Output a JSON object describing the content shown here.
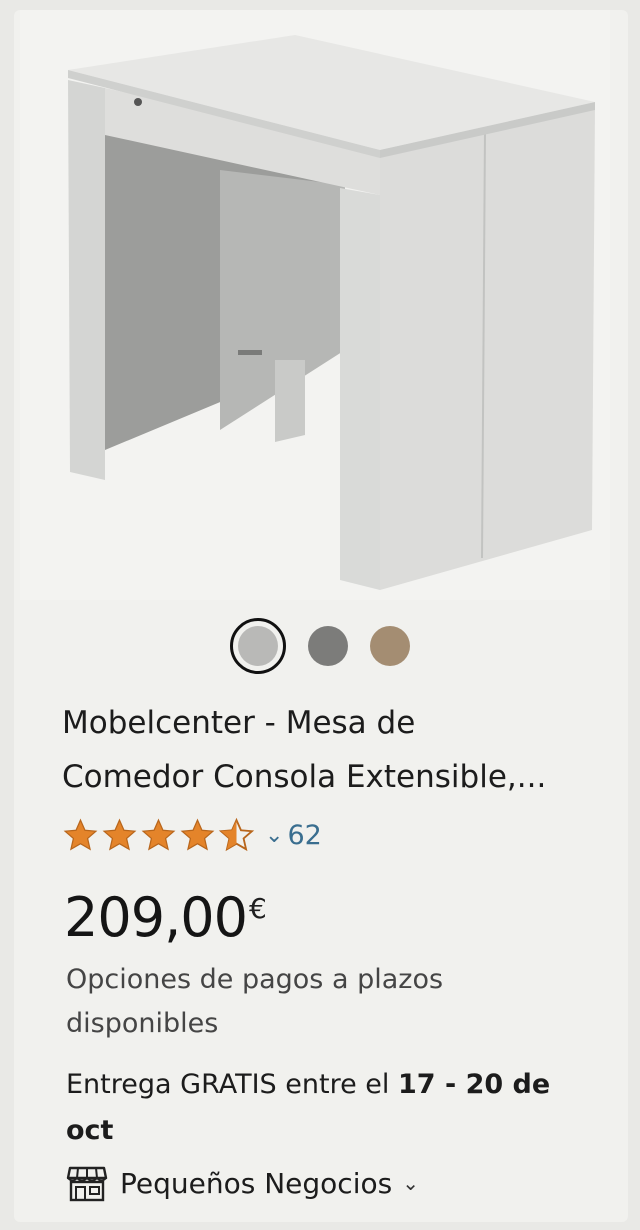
{
  "colors": {
    "star": "#e4842a",
    "link": "#3a6e8f",
    "swatch_white": "#b9b9b7",
    "swatch_grey": "#7c7c7a",
    "swatch_oak": "#a48d72"
  },
  "swatches": [
    {
      "name": "white",
      "color": "#b9b9b7",
      "selected": true
    },
    {
      "name": "grey",
      "color": "#7c7c7a",
      "selected": false
    },
    {
      "name": "oak",
      "color": "#a48d72",
      "selected": false
    }
  ],
  "product": {
    "title_line1": "Mobelcenter - Mesa de",
    "title_line2": "Comedor Consola Extensible,...",
    "rating": 4.5,
    "rating_count": "62",
    "price_amount": "209,00",
    "price_currency": "€",
    "installments_line1": "Opciones de pagos a plazos",
    "installments_line2": "disponibles",
    "delivery_prefix": "Entrega GRATIS entre el ",
    "delivery_dates": "17 - 20 de",
    "delivery_line2": "oct",
    "small_business_label": "Pequeños Negocios"
  },
  "icons": {
    "rating_dropdown": "chevron-down-icon",
    "small_business": "store-icon",
    "small_business_dropdown": "chevron-down-icon"
  }
}
